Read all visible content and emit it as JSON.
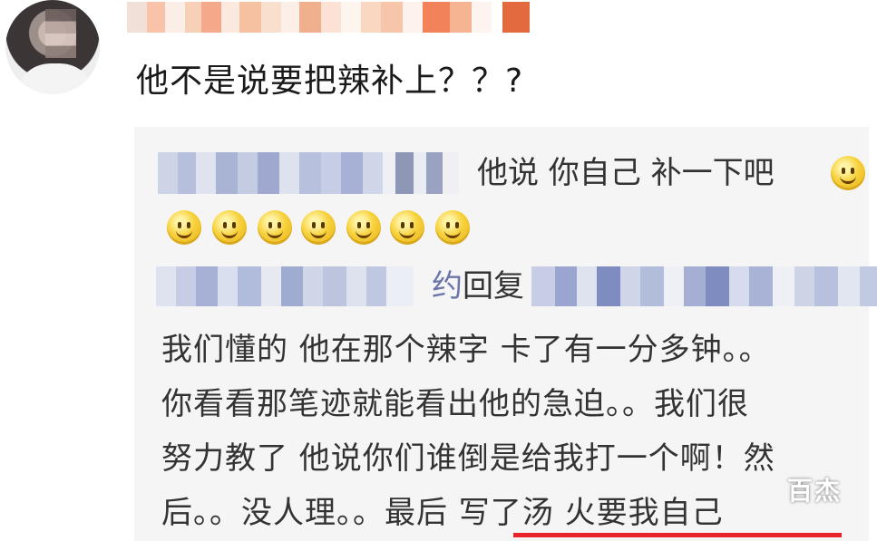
{
  "comment": {
    "text": "他不是说要把辣补上？？?"
  },
  "replies": [
    {
      "text": "他说 你自己 补一下吧",
      "emoji_icon": "smile-emoji-icon",
      "emoji_count": 8
    },
    {
      "prefix_fragment": "约",
      "reply_word": "回复",
      "body_lines": [
        "我们懂的 他在那个辣字 卡了有一分多钟。。",
        "你看看那笔迹就能看出他的急迫。。我们很",
        "努力教了 他说你们谁倒是给我打一个啊！然",
        "后。。没人理。。最后 写了汤 火要我自己"
      ]
    }
  ],
  "watermark": "百杰",
  "colors": {
    "reply_background": "#f5f5f5",
    "underline": "#e8232a",
    "emoji": "#f7d23d"
  }
}
